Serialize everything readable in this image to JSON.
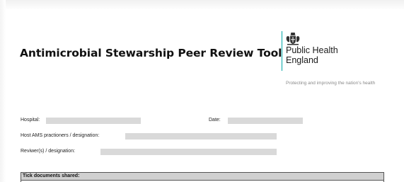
{
  "document": {
    "title": "Antimicrobial Stewarship Peer Review Tool"
  },
  "logo": {
    "icon": "royal-crest-icon",
    "line1": "Public Health",
    "line2": "England",
    "strapline": "Protecting and improving the nation's health",
    "accent_color": "#00a5a5"
  },
  "form": {
    "hospital_label": "Hospital:",
    "date_label": "Date:",
    "host_label": "Host AMS practioners / designation:",
    "reviewer_label": "Reviwer(s) / designation:",
    "hospital_value": "",
    "date_value": "",
    "host_value": "",
    "reviewer_value": "",
    "field_color": "#d9d9d9"
  },
  "documents_shared": {
    "header": "Tick documents shared:"
  }
}
